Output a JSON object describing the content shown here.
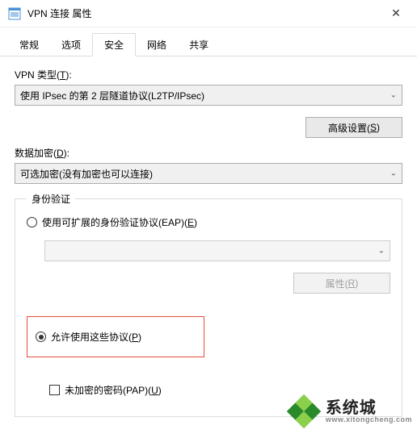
{
  "window": {
    "title": "VPN 连接 属性"
  },
  "tabs": {
    "items": [
      "常规",
      "选项",
      "安全",
      "网络",
      "共享"
    ],
    "active": "安全"
  },
  "security": {
    "vpn_type_label_pre": "VPN 类型(",
    "vpn_type_label_u": "T",
    "vpn_type_label_post": "):",
    "vpn_type_value": "使用 IPsec 的第 2 层隧道协议(L2TP/IPsec)",
    "advanced_button_pre": "高级设置(",
    "advanced_button_u": "S",
    "advanced_button_post": ")",
    "encryption_label_pre": "数据加密(",
    "encryption_label_u": "D",
    "encryption_label_post": "):",
    "encryption_value": "可选加密(没有加密也可以连接)",
    "auth_legend": "身份验证",
    "eap_label_pre": "使用可扩展的身份验证协议(EAP)(",
    "eap_label_u": "E",
    "eap_label_post": ")",
    "eap_dropdown_value": "",
    "properties_button_pre": "属性(",
    "properties_button_u": "R",
    "properties_button_post": ")",
    "allow_label_pre": "允许使用这些协议(",
    "allow_label_u": "P",
    "allow_label_post": ")",
    "pap_label_pre": "未加密的密码(PAP)(",
    "pap_label_u": "U",
    "pap_label_post": ")"
  },
  "watermark": {
    "main": "系统城",
    "sub": "www.xitongcheng.com"
  }
}
